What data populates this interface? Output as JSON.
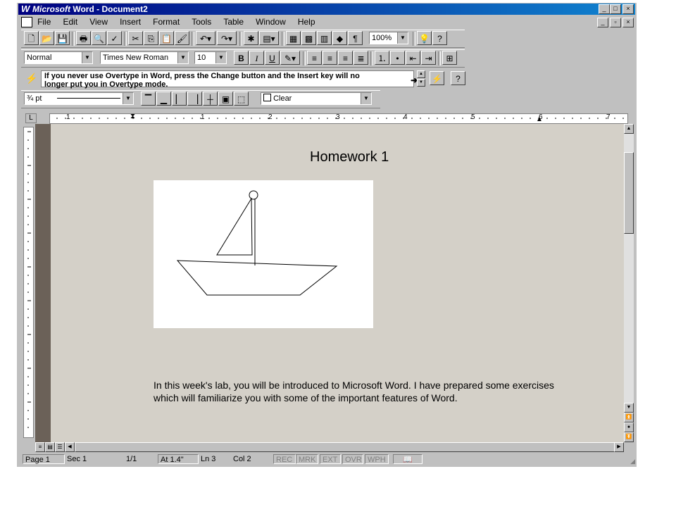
{
  "window": {
    "title_brand": "Microsoft",
    "title_rest": "Word - Document2",
    "controls": {
      "minimize": "_",
      "maximize": "□",
      "close": "×"
    }
  },
  "menu": [
    "File",
    "Edit",
    "View",
    "Insert",
    "Format",
    "Tools",
    "Table",
    "Window",
    "Help"
  ],
  "standard_toolbar": {
    "zoom": "100%"
  },
  "formatting_toolbar": {
    "style": "Normal",
    "font": "Times New Roman",
    "size": "10",
    "bold": "B",
    "italic": "I",
    "underline": "U"
  },
  "tip": {
    "line1": "If you never use Overtype in Word, press the Change button and the Insert key will no",
    "line2": "longer put you in Overtype mode."
  },
  "borders_toolbar": {
    "line_weight": "¾ pt",
    "shading": "Clear"
  },
  "ruler": {
    "numbers": [
      "1",
      "1",
      "2",
      "3",
      "4",
      "5",
      "6",
      "7"
    ]
  },
  "document": {
    "title": "Homework 1",
    "paragraph": "In this week's lab, you will be introduced to Microsoft Word. I have prepared some exercises which will familiarize you with some of the important features of Word."
  },
  "status": {
    "page": "Page 1",
    "sec": "Sec 1",
    "pages": "1/1",
    "at": "At 1.4\"",
    "ln": "Ln 3",
    "col": "Col 2",
    "rec": "REC",
    "mrk": "MRK",
    "ext": "EXT",
    "ovr": "OVR",
    "wph": "WPH"
  }
}
